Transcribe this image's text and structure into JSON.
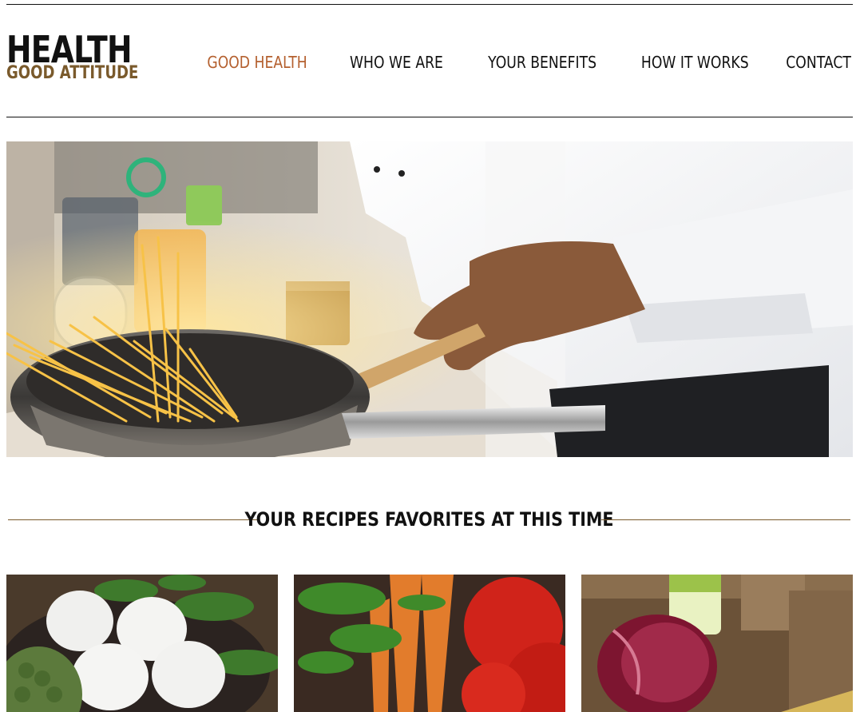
{
  "brand": {
    "title": "HEALTH",
    "subtitle": "GOOD ATTITUDE"
  },
  "nav": {
    "items": [
      {
        "label": "GOOD HEALTH",
        "active": true
      },
      {
        "label": "WHO WE ARE",
        "active": false
      },
      {
        "label": "YOUR BENEFITS",
        "active": false
      },
      {
        "label": "HOW IT WORKS",
        "active": false
      },
      {
        "label": "CONTACT",
        "active": false
      }
    ]
  },
  "section": {
    "title": "YOUR RECIPES FAVORITES AT THIS TIME"
  },
  "colors": {
    "accent": "#b4602f",
    "brand_sub": "#7a5a2c",
    "text": "#111111"
  }
}
